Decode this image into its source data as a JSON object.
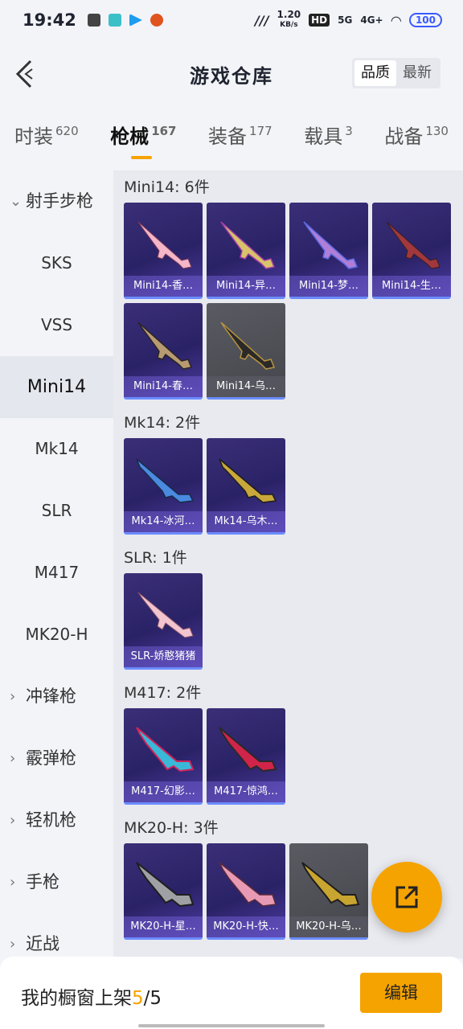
{
  "status": {
    "time": "19:42",
    "net_speed": "1.20",
    "net_unit": "KB/s",
    "signal1": "HD",
    "signal2": "5G",
    "signal3": "4G+",
    "battery": "100"
  },
  "header": {
    "title": "游戏仓库",
    "sort_quality": "品质",
    "sort_newest": "最新"
  },
  "tabs": [
    {
      "label": "时装",
      "count": "620"
    },
    {
      "label": "枪械",
      "count": "167"
    },
    {
      "label": "装备",
      "count": "177"
    },
    {
      "label": "载具",
      "count": "3"
    },
    {
      "label": "战备",
      "count": "130"
    }
  ],
  "sidebar": {
    "group_rifles": "射手步枪",
    "items": [
      "SKS",
      "VSS",
      "Mini14",
      "Mk14",
      "SLR",
      "M417",
      "MK20-H"
    ],
    "groups": [
      "冲锋枪",
      "霰弹枪",
      "轻机枪",
      "手枪",
      "近战"
    ]
  },
  "sections": [
    {
      "title": "Mini14: 6件",
      "cards": [
        "Mini14-香…",
        "Mini14-异…",
        "Mini14-梦…",
        "Mini14-生…",
        "Mini14-春…",
        "Mini14-乌…"
      ]
    },
    {
      "title": "Mk14: 2件",
      "cards": [
        "Mk14-冰河…",
        "Mk14-乌木…"
      ]
    },
    {
      "title": "SLR: 1件",
      "cards": [
        "SLR-娇憨猪猪"
      ]
    },
    {
      "title": "M417: 2件",
      "cards": [
        "M417-幻影…",
        "M417-惊鸿…"
      ]
    },
    {
      "title": "MK20-H: 3件",
      "cards": [
        "MK20-H-星…",
        "MK20-H-快…",
        "MK20-H-乌…"
      ]
    }
  ],
  "bottom": {
    "text": "我的橱窗上架",
    "current": "5",
    "sep": "/",
    "total": "5",
    "edit_label": "编辑"
  },
  "colors": {
    "accent": "#f5a300",
    "card_purple": "#2a2266",
    "card_gray": "#4a4b52"
  }
}
